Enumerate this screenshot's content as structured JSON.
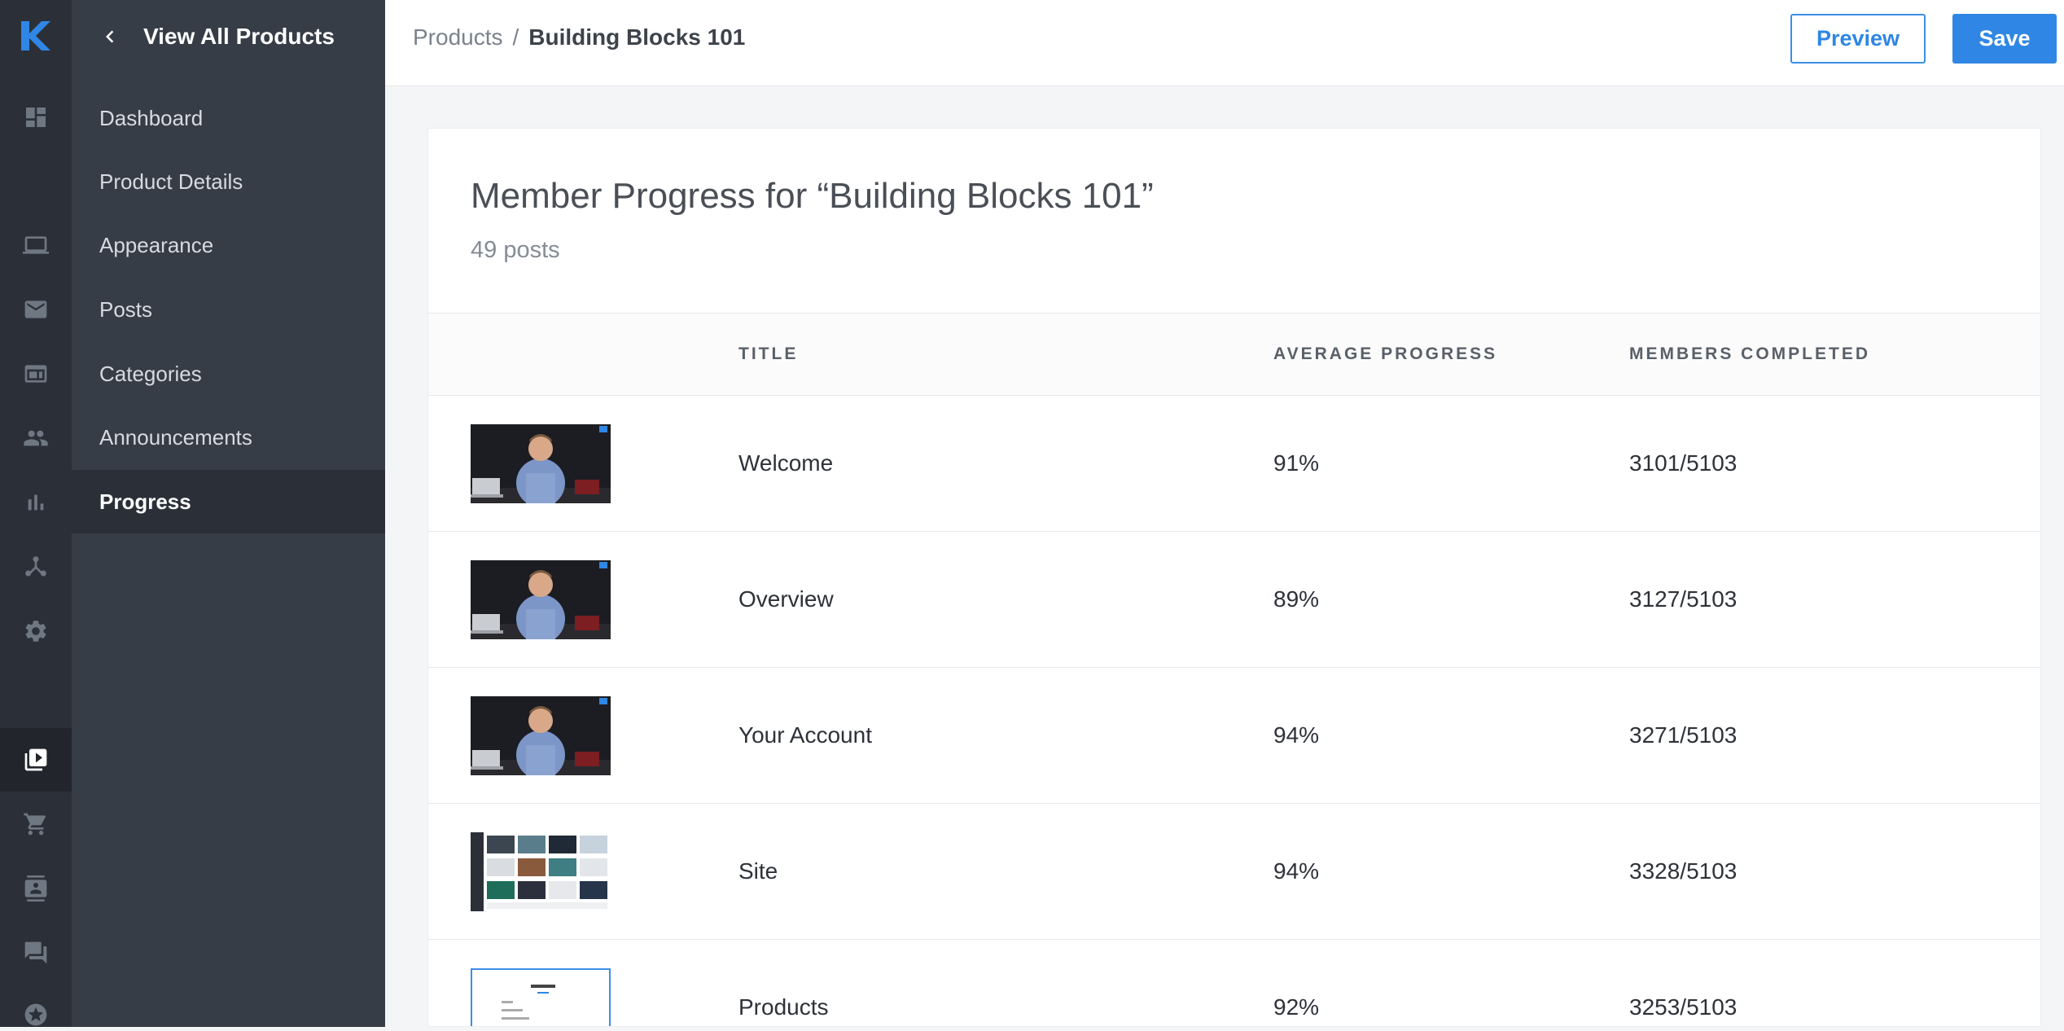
{
  "rail": {
    "icons": [
      "kajabi-logo-icon",
      "dashboard-icon",
      "laptop-icon",
      "mail-icon",
      "website-icon",
      "people-icon",
      "bar-chart-icon",
      "pipeline-icon",
      "gear-icon",
      "video-library-icon",
      "cart-icon",
      "contacts-icon",
      "chat-icon",
      "star-icon"
    ],
    "active": "video-library-icon",
    "brand_color": "#2f86e4"
  },
  "sidebar": {
    "back_label": "View All Products",
    "items": [
      {
        "label": "Dashboard"
      },
      {
        "label": "Product Details"
      },
      {
        "label": "Appearance"
      },
      {
        "label": "Posts"
      },
      {
        "label": "Categories"
      },
      {
        "label": "Announcements"
      },
      {
        "label": "Progress",
        "active": true
      }
    ]
  },
  "header": {
    "breadcrumb_parent": "Products",
    "breadcrumb_separator": "/",
    "breadcrumb_current": "Building Blocks 101",
    "preview_label": "Preview",
    "save_label": "Save"
  },
  "main": {
    "title": "Member Progress for “Building Blocks 101”",
    "subtitle": "49 posts",
    "columns": [
      "TITLE",
      "AVERAGE PROGRESS",
      "MEMBERS COMPLETED"
    ],
    "rows": [
      {
        "thumbnail": "video-thumbnail",
        "title": "Welcome",
        "average_progress": "91%",
        "members_completed": "3101/5103"
      },
      {
        "thumbnail": "video-thumbnail",
        "title": "Overview",
        "average_progress": "89%",
        "members_completed": "3127/5103"
      },
      {
        "thumbnail": "video-thumbnail",
        "title": "Your Account",
        "average_progress": "94%",
        "members_completed": "3271/5103"
      },
      {
        "thumbnail": "site-thumbnail",
        "title": "Site",
        "average_progress": "94%",
        "members_completed": "3328/5103"
      },
      {
        "thumbnail": "products-thumbnail",
        "title": "Products",
        "average_progress": "92%",
        "members_completed": "3253/5103"
      }
    ]
  }
}
